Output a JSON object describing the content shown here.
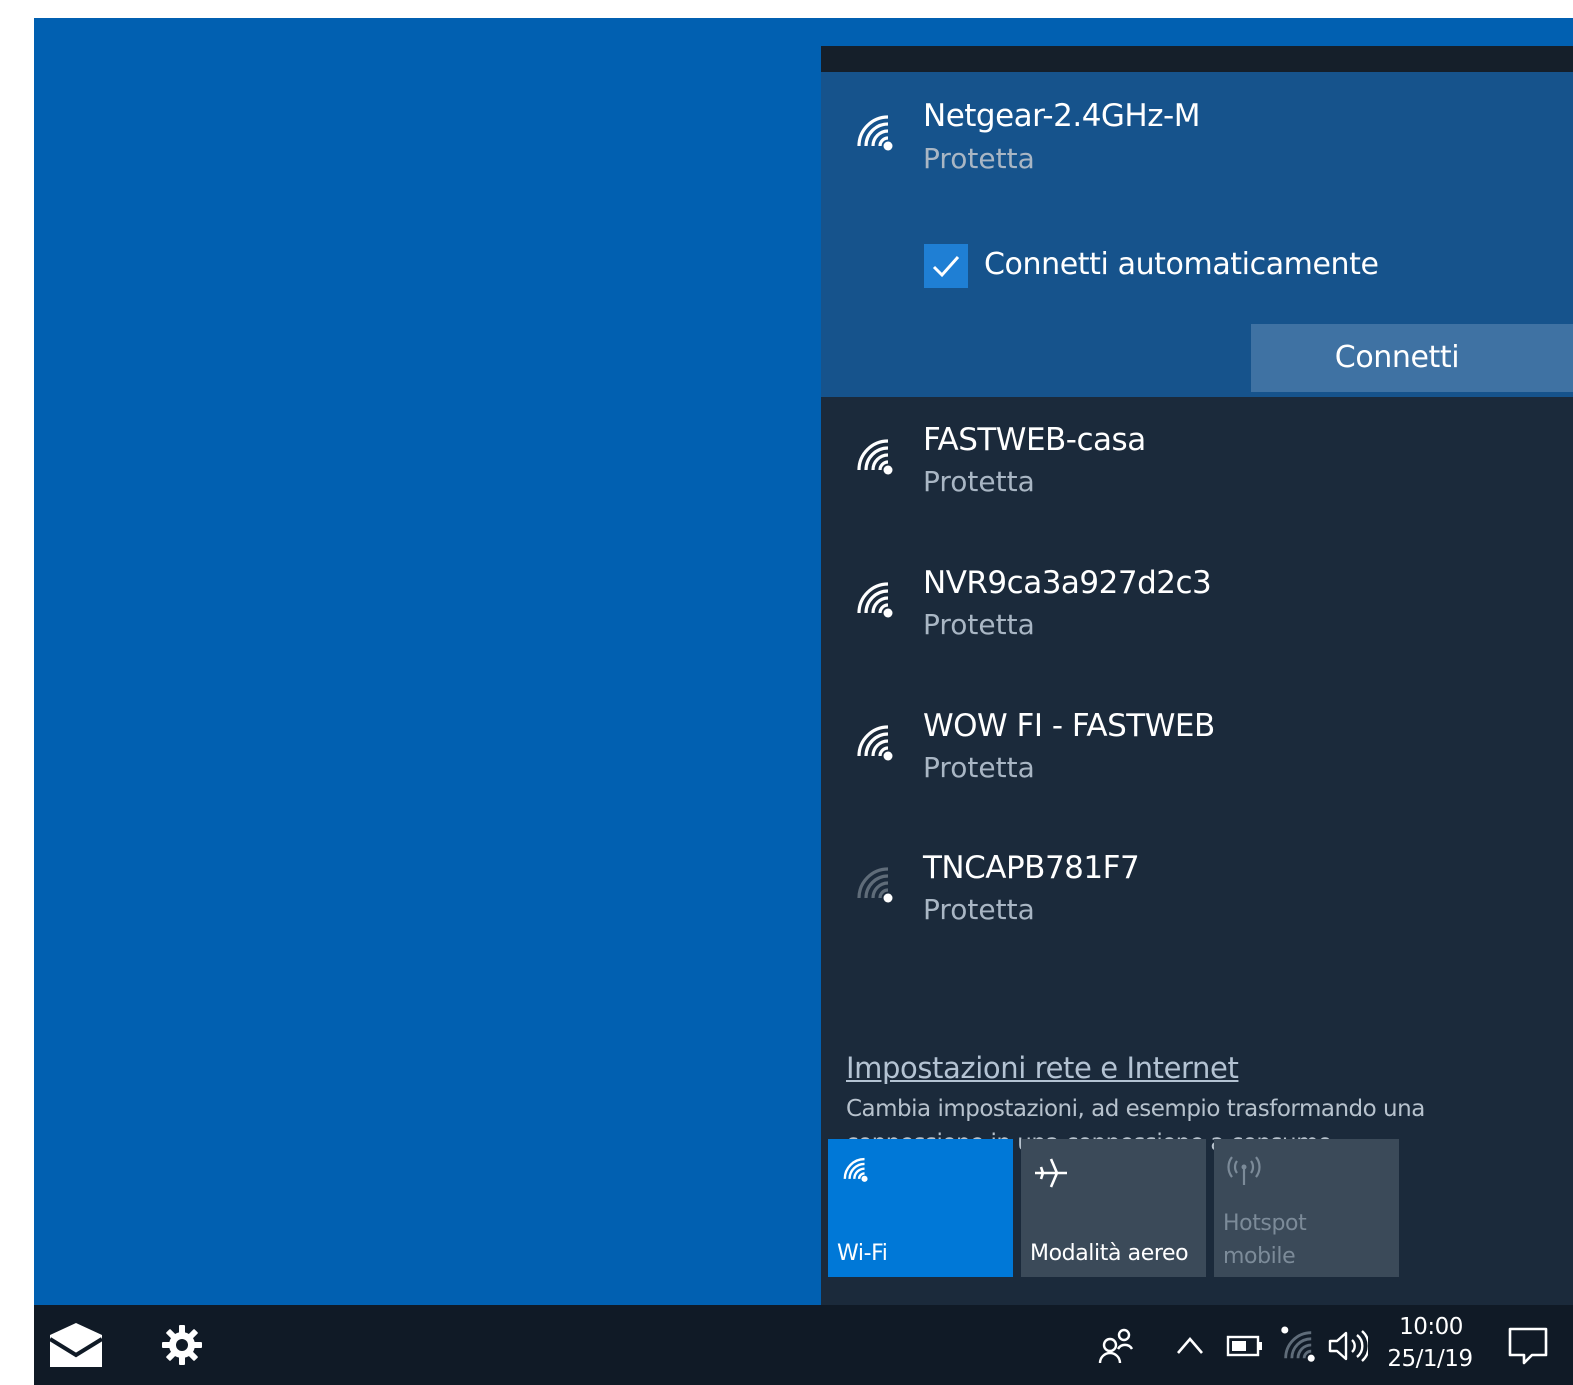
{
  "networks": {
    "selected": {
      "name": "Netgear-2.4GHz-M",
      "status": "Protetta",
      "auto_connect_label": "Connetti automaticamente",
      "auto_connect_checked": true,
      "connect_button": "Connetti"
    },
    "items": [
      {
        "name": "FASTWEB-casa",
        "status": "Protetta",
        "signal": "strong"
      },
      {
        "name": "NVR9ca3a927d2c3",
        "status": "Protetta",
        "signal": "strong"
      },
      {
        "name": "WOW FI - FASTWEB",
        "status": "Protetta",
        "signal": "strong"
      },
      {
        "name": "TNCAPB781F7",
        "status": "Protetta",
        "signal": "weak"
      }
    ]
  },
  "settings": {
    "link": "Impostazioni rete e Internet",
    "description": "Cambia impostazioni, ad esempio trasformando una connessione in una connessione a consumo."
  },
  "quick_actions": [
    {
      "label": "Wi-Fi",
      "icon": "wifi-icon",
      "active": true
    },
    {
      "label": "Modalità aereo",
      "icon": "airplane-icon",
      "active": false
    },
    {
      "label": "Hotspot mobile",
      "icon": "hotspot-icon",
      "active": false,
      "disabled": true
    }
  ],
  "taskbar": {
    "time": "10:00",
    "date": "25/1/19",
    "icons": [
      "mail-icon",
      "gear-icon",
      "people-icon",
      "chevron-up-icon",
      "battery-icon",
      "wifi-icon",
      "volume-icon",
      "notification-icon"
    ]
  },
  "colors": {
    "desktop": "#0160b1",
    "flyout": "#1b2a3b",
    "selected": "#16538c",
    "accent": "#0078d7"
  }
}
